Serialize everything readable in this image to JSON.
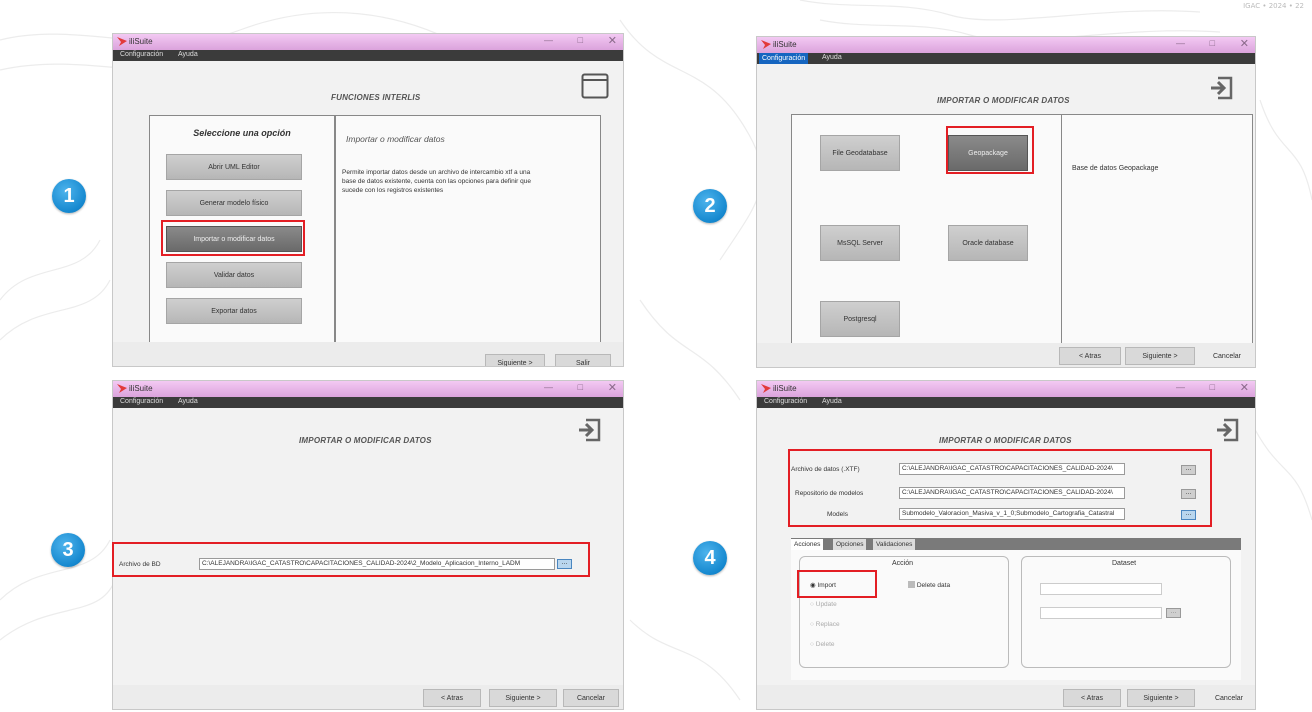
{
  "corner_note": "IGAC • 2024 • 22",
  "steps": [
    "1",
    "2",
    "3",
    "4"
  ],
  "app": {
    "title": "iliSuite",
    "menu": {
      "config": "Configuración",
      "help": "Ayuda"
    }
  },
  "win1": {
    "header": "FUNCIONES INTERLIS",
    "panel_title": "Seleccione una opción",
    "options": [
      "Abrir UML Editor",
      "Generar modelo físico",
      "Importar o modificar datos",
      "Validar datos",
      "Exportar datos"
    ],
    "desc_title": "Importar o modificar datos",
    "desc_lines": [
      "Permite importar datos desde un archivo de intercambio xtf a una",
      "base de datos existente, cuenta con las opciones para definir que",
      "sucede con los registros existentes"
    ],
    "next": "Siguiente >",
    "exit": "Salir"
  },
  "win2": {
    "header": "IMPORTAR O MODIFICAR DATOS",
    "db_options": [
      "File Geodatabase",
      "Geopackage",
      "MsSQL Server",
      "Oracle database",
      "Postgresql"
    ],
    "description": "Base de datos Geopackage",
    "back": "< Atras",
    "next": "Siguiente >",
    "cancel": "Cancelar"
  },
  "win3": {
    "header": "IMPORTAR O MODIFICAR DATOS",
    "field_label": "Archivo de BD",
    "field_value": "C:\\ALEJANDRA\\IGAC_CATASTRO\\CAPACITACIONES_CALIDAD-2024\\2_Modelo_Aplicacion_Interno_LADM",
    "browse": "...",
    "back": "< Atras",
    "next": "Siguiente >",
    "cancel": "Cancelar"
  },
  "win4": {
    "header": "IMPORTAR O MODIFICAR DATOS",
    "rows": [
      {
        "label": "Archivo de datos (.XTF)",
        "value": "C:\\ALEJANDRA\\IGAC_CATASTRO\\CAPACITACIONES_CALIDAD-2024\\"
      },
      {
        "label": "Repositorio de modelos",
        "value": "C:\\ALEJANDRA\\IGAC_CATASTRO\\CAPACITACIONES_CALIDAD-2024\\"
      },
      {
        "label": "Models",
        "value": "Submodelo_Valoracion_Masiva_v_1_0;Submodelo_Cartografia_Catastral"
      }
    ],
    "browse": "...",
    "tabs": [
      "Acciones",
      "Opciones",
      "Validaciones"
    ],
    "accion_title": "Acción",
    "dataset_title": "Dataset",
    "radios": [
      "Import",
      "Update",
      "Replace",
      "Delete"
    ],
    "delete_data": "Delete data",
    "back": "< Atras",
    "next": "Siguiente >",
    "cancel": "Cancelar"
  },
  "colors": {
    "highlight": "#e31e24",
    "badge": "#1588cf",
    "titlebar": "#dba3dc",
    "menubar": "#3b3b3b"
  }
}
